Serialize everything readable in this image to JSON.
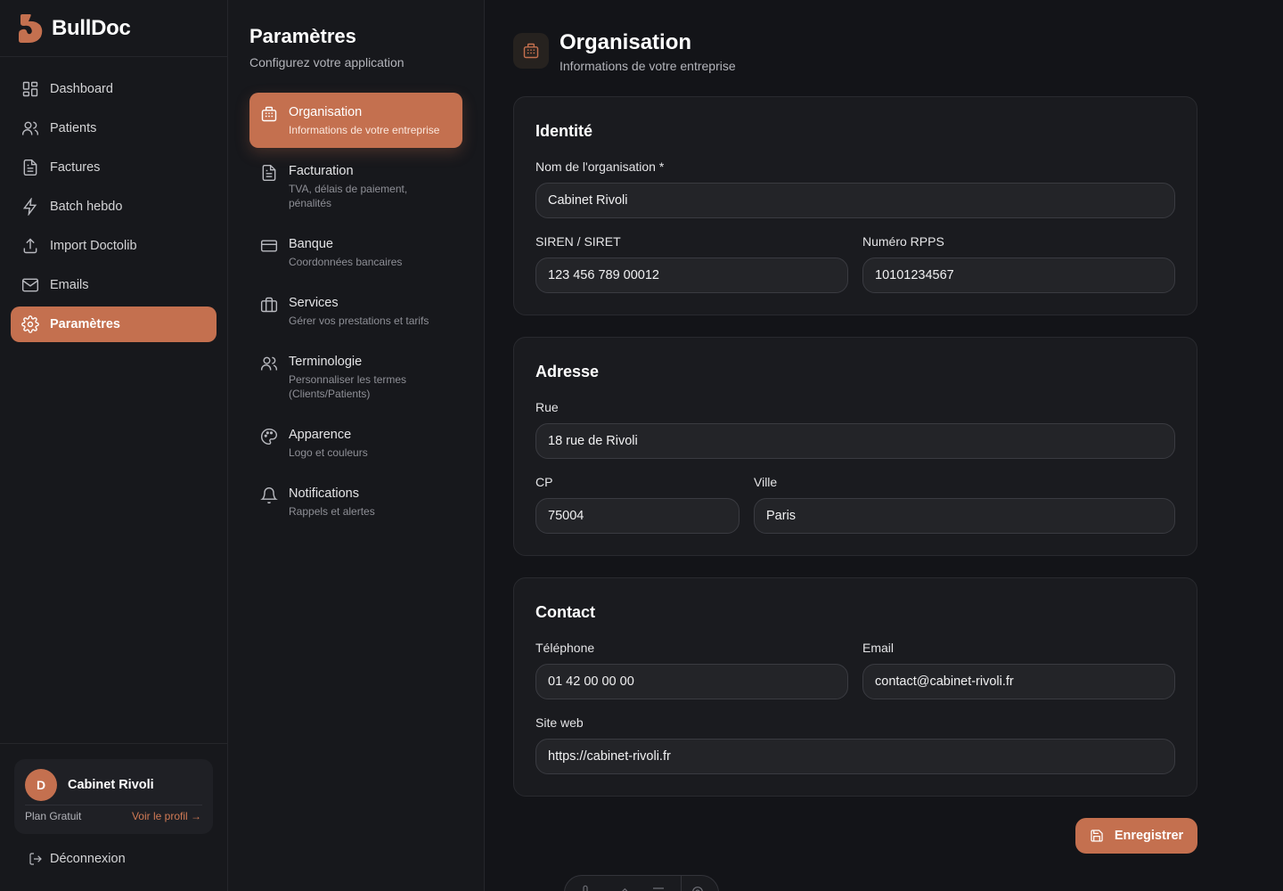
{
  "brand": {
    "name": "BullDoc",
    "accent": "#c4704f"
  },
  "sidebar": {
    "items": [
      {
        "label": "Dashboard",
        "icon": "dashboard-icon"
      },
      {
        "label": "Patients",
        "icon": "users-icon"
      },
      {
        "label": "Factures",
        "icon": "document-icon"
      },
      {
        "label": "Batch hebdo",
        "icon": "lightning-icon"
      },
      {
        "label": "Import Doctolib",
        "icon": "upload-icon"
      },
      {
        "label": "Emails",
        "icon": "mail-icon"
      },
      {
        "label": "Paramètres",
        "icon": "gear-icon",
        "active": true
      }
    ],
    "profile": {
      "initial": "D",
      "name": "Cabinet Rivoli",
      "plan": "Plan Gratuit",
      "link": "Voir le profil →"
    },
    "logout": "Déconnexion"
  },
  "settings": {
    "title": "Paramètres",
    "subtitle": "Configurez votre application",
    "items": [
      {
        "label": "Organisation",
        "desc": "Informations de votre entreprise",
        "icon": "building-icon",
        "active": true
      },
      {
        "label": "Facturation",
        "desc": "TVA, délais de paiement, pénalités",
        "icon": "document-icon"
      },
      {
        "label": "Banque",
        "desc": "Coordonnées bancaires",
        "icon": "credit-card-icon"
      },
      {
        "label": "Services",
        "desc": "Gérer vos prestations et tarifs",
        "icon": "briefcase-icon"
      },
      {
        "label": "Terminologie",
        "desc": "Personnaliser les termes (Clients/Patients)",
        "icon": "users-icon"
      },
      {
        "label": "Apparence",
        "desc": "Logo et couleurs",
        "icon": "palette-icon"
      },
      {
        "label": "Notifications",
        "desc": "Rappels et alertes",
        "icon": "bell-icon"
      }
    ]
  },
  "page": {
    "title": "Organisation",
    "subtitle": "Informations de votre entreprise"
  },
  "identity": {
    "title": "Identité",
    "org_name_label": "Nom de l'organisation *",
    "org_name": "Cabinet Rivoli",
    "siren_label": "SIREN / SIRET",
    "siren": "123 456 789 00012",
    "rpps_label": "Numéro RPPS",
    "rpps": "10101234567"
  },
  "address": {
    "title": "Adresse",
    "street_label": "Rue",
    "street": "18 rue de Rivoli",
    "cp_label": "CP",
    "cp": "75004",
    "city_label": "Ville",
    "city": "Paris"
  },
  "contact": {
    "title": "Contact",
    "phone_label": "Téléphone",
    "phone": "01 42 00 00 00",
    "email_label": "Email",
    "email": "contact@cabinet-rivoli.fr",
    "website_label": "Site web",
    "website": "https://cabinet-rivoli.fr"
  },
  "actions": {
    "save": "Enregistrer"
  }
}
